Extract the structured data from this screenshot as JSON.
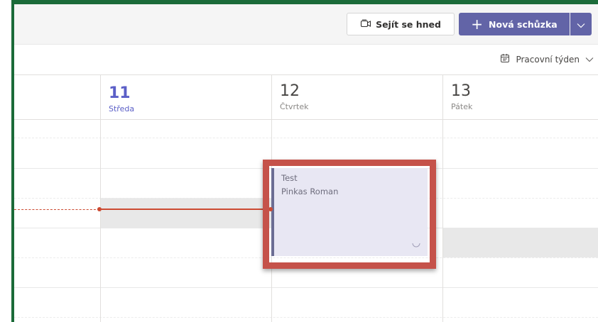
{
  "toolbar": {
    "meet_now_label": "Sejít se hned",
    "new_meeting_label": "Nová schůzka",
    "brand_color": "#6264a7"
  },
  "view": {
    "selected": "Pracovní týden"
  },
  "days": [
    {
      "number": "11",
      "name": "Středa",
      "today": true
    },
    {
      "number": "12",
      "name": "Čtvrtek",
      "today": false
    },
    {
      "number": "13",
      "name": "Pátek",
      "today": false
    }
  ],
  "event": {
    "title": "Test",
    "organizer": "Pinkas Roman"
  },
  "colors": {
    "frame": "#1b6b39",
    "current_time": "#cc4a31",
    "highlight": "#c5524a"
  }
}
